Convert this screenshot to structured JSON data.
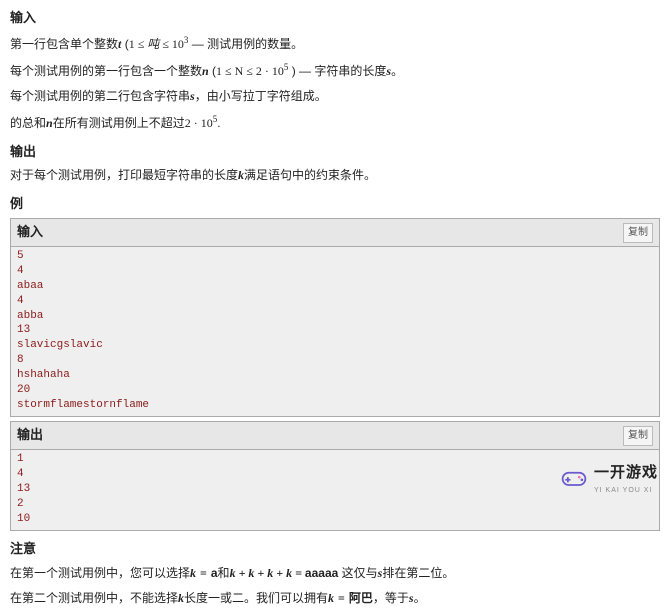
{
  "input_section": {
    "heading": "输入",
    "p1_a": "第一行包含单个整数",
    "p1_var_t": "t",
    "p1_b": " (",
    "p1_eq_left": "1 ≤ ",
    "p1_eq_var": "吨",
    "p1_eq_right": " ≤ 10",
    "p1_exp": "3",
    "p1_c": " — 测试用例的数量。",
    "p2_a": "每个测试用例的第一行包含一个整数",
    "p2_var_n": "n",
    "p2_b": " (",
    "p2_eq": "1 ≤ N ≤ 2 · 10",
    "p2_exp": "5",
    "p2_c": " )   — 字符串的长度",
    "p2_var_s": "s",
    "p2_d": "。",
    "p3_a": "每个测试用例的第二行包含字符串",
    "p3_var_s": "s",
    "p3_b": "，由小写拉丁字符组成。",
    "p4_a": "的总和",
    "p4_var_n": "n",
    "p4_b": "在所有测试用例上不超过",
    "p4_eq": "2 · 10",
    "p4_exp": "5",
    "p4_c": "."
  },
  "output_section": {
    "heading": "输出",
    "p1_a": "对于每个测试用例，打印最短字符串的长度",
    "p1_var_k": "k",
    "p1_b": "满足语句中的约束条件。"
  },
  "example_section": {
    "heading": "例",
    "input_label": "输入",
    "output_label": "输出",
    "copy_label": "复制",
    "input_lines": [
      "5",
      "4",
      "abaa",
      "4",
      "abba",
      "13",
      "slavicgslavic",
      "8",
      "hshahaha",
      "20",
      "stormflamestornflame"
    ],
    "output_lines": [
      "1",
      "4",
      "13",
      "2",
      "10"
    ]
  },
  "notes_section": {
    "heading": "注意",
    "p1_a": "在第一个测试用例中，您可以选择",
    "p1_eq1_lhs": "k",
    "p1_eq1_rhs": "a",
    "p1_b": "和",
    "p1_eq2": "k + k + k + k",
    "p1_eq2_rhs": "aaaaa",
    "p1_c": " 这仅与",
    "p1_var_s": "s",
    "p1_d": "排在第二位。",
    "p2_a": "在第二个测试用例中，不能选择",
    "p2_var_k": "k",
    "p2_b": "长度一或二。我们可以拥有",
    "p2_eq_lhs": "k",
    "p2_eq_rhs": "阿巴",
    "p2_c": "，等于",
    "p2_var_s": "s",
    "p2_d": "。"
  },
  "logo": {
    "main": "一开游戏",
    "sub": "YI KAI YOU XI"
  }
}
